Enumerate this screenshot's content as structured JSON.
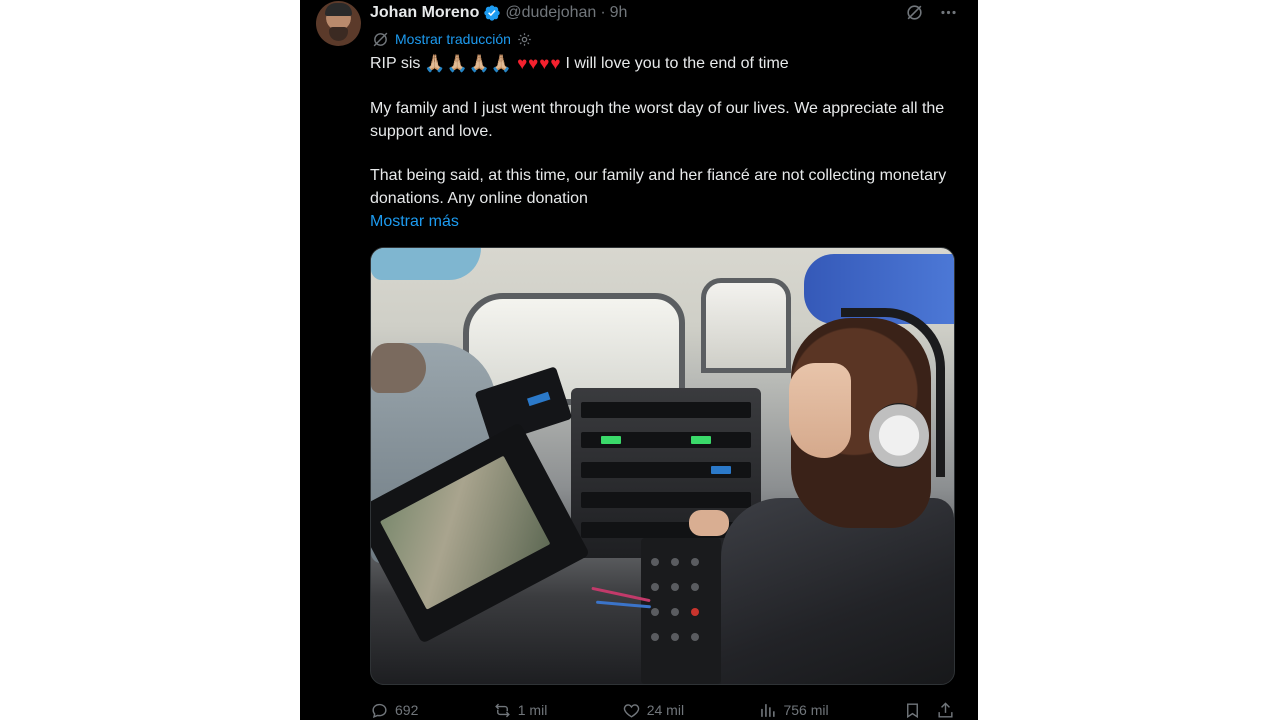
{
  "tweet": {
    "author": {
      "display_name": "Johan Moreno",
      "handle": "@dudejohan",
      "time": "9h",
      "separator": "·"
    },
    "translate_label": "Mostrar traducción",
    "text": {
      "line1_prefix": "RIP sis",
      "line1_emojis_hands": "🙏🏼🙏🏼🙏🏼🙏🏼",
      "line1_emojis_hearts": "♥♥♥♥",
      "line1_suffix": "I will love you to the end of time",
      "paragraph2": "My family and I just went through the worst day of our lives. We appreciate all the support and love.",
      "paragraph3": "That being said, at this time, our family and her fiancé are not collecting monetary donations. Any online donation"
    },
    "show_more": "Mostrar más",
    "stats": {
      "replies": "692",
      "reposts": "1 mil",
      "likes": "24 mil",
      "views": "756 mil"
    }
  },
  "colors": {
    "background": "#000000",
    "text": "#e7e9ea",
    "muted": "#71767b",
    "accent": "#1d9bf0"
  },
  "icons": {
    "verified": "verified-badge-icon",
    "grok": "grok-icon",
    "more": "more-icon",
    "translate": "translate-icon",
    "settings": "gear-icon",
    "reply": "reply-icon",
    "repost": "repost-icon",
    "like": "heart-icon",
    "views": "views-icon",
    "bookmark": "bookmark-icon",
    "share": "share-icon"
  }
}
